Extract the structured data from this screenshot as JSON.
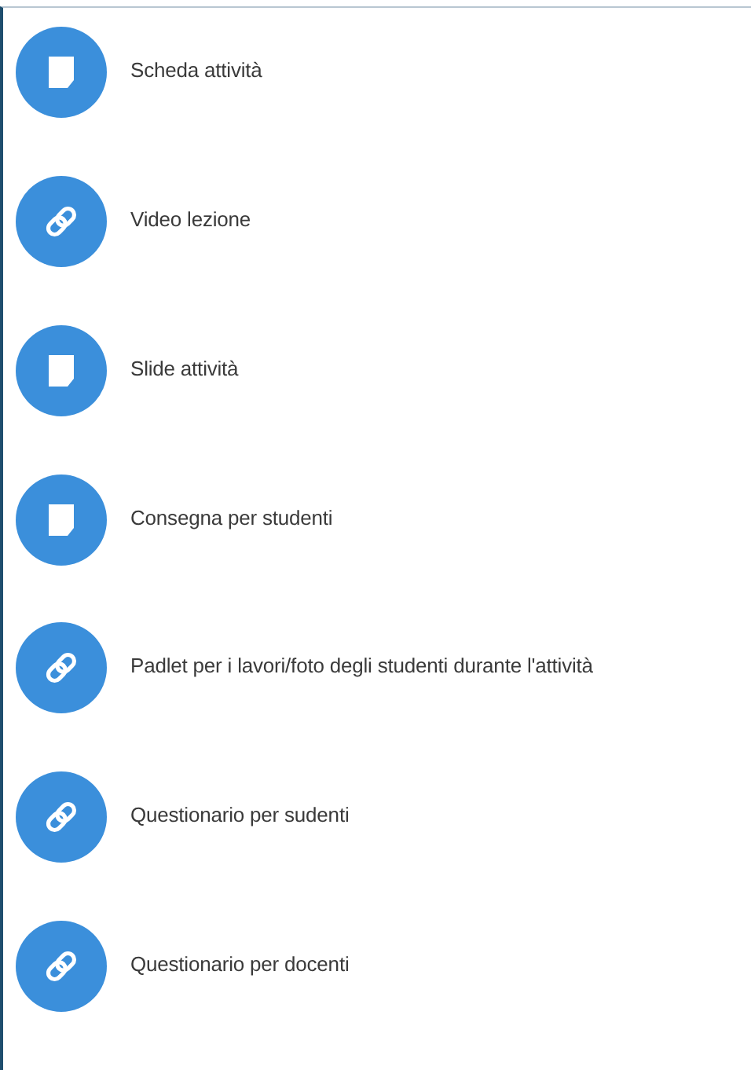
{
  "items": [
    {
      "kind": "page",
      "label": "Scheda attività"
    },
    {
      "kind": "link",
      "label": "Video lezione"
    },
    {
      "kind": "page",
      "label": "Slide attività"
    },
    {
      "kind": "page",
      "label": "Consegna per studenti"
    },
    {
      "kind": "link",
      "label": "Padlet per i lavori/foto degli studenti durante l'attività"
    },
    {
      "kind": "link",
      "label": "Questionario per sudenti"
    },
    {
      "kind": "link",
      "label": "Questionario per docenti"
    }
  ]
}
